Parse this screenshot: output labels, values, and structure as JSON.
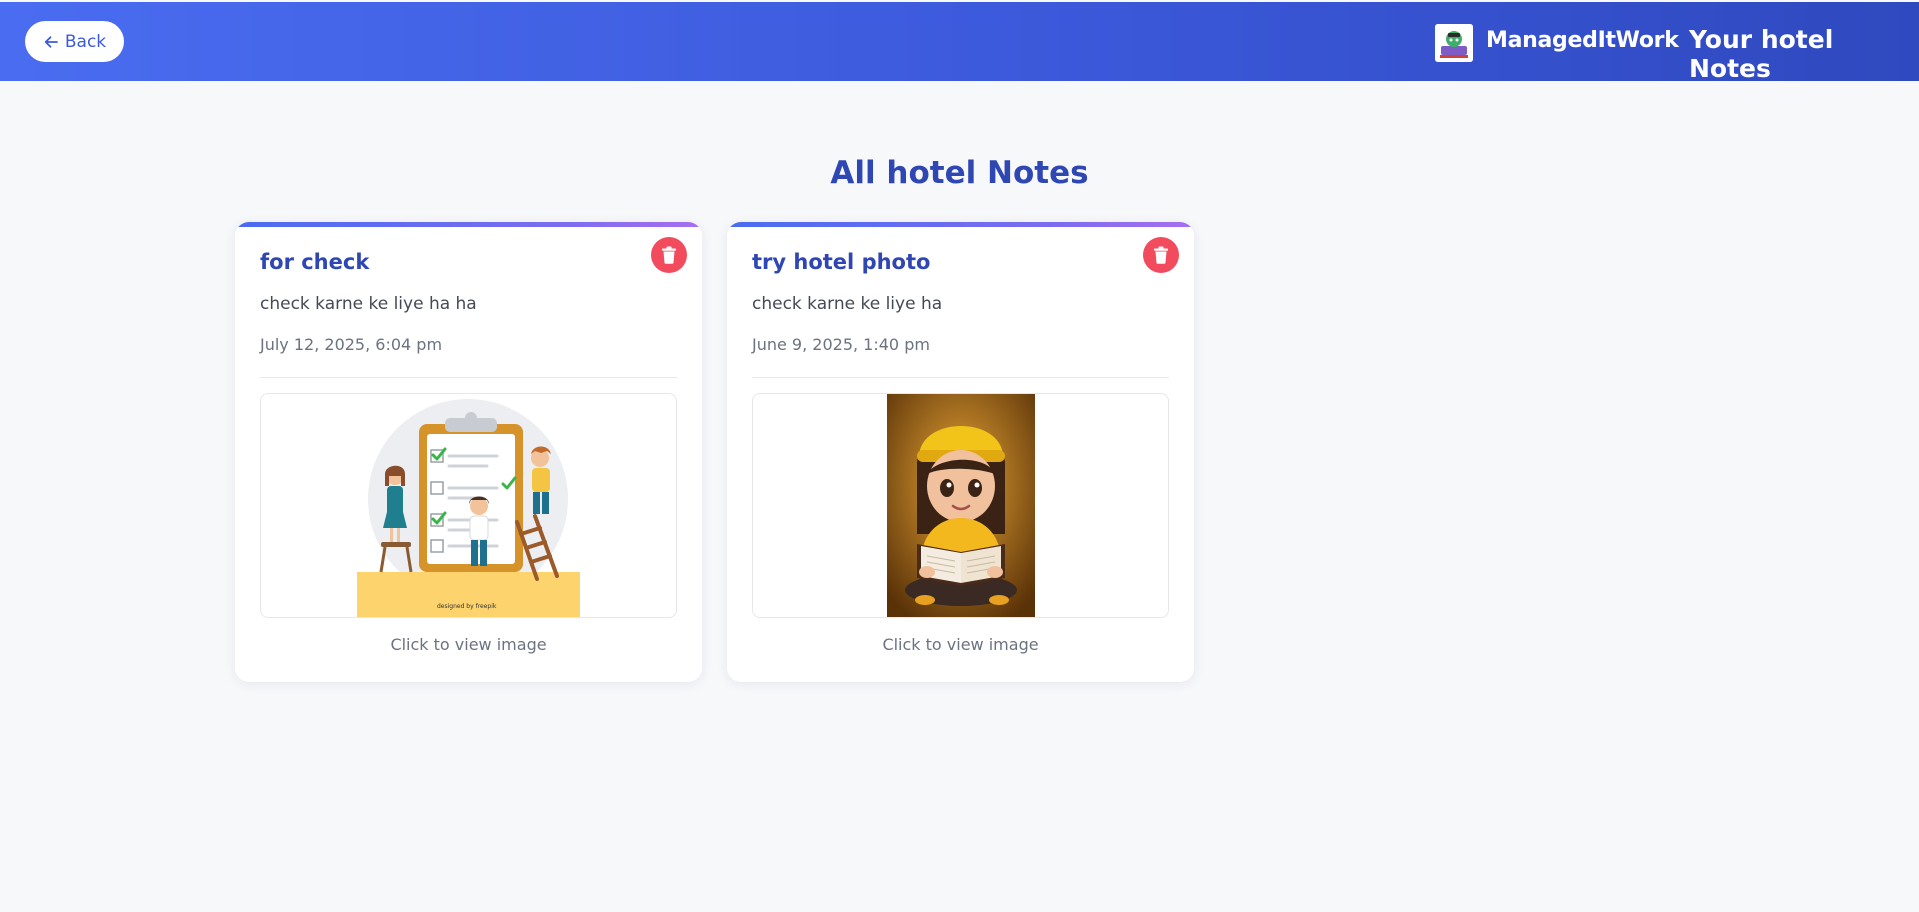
{
  "header": {
    "back_label": "Back",
    "brand_name": "ManagedItWork",
    "page_heading": "Your hotel Notes"
  },
  "main": {
    "title": "All hotel Notes"
  },
  "notes": [
    {
      "title": "for check",
      "body": "check karne ke liye ha ha",
      "date": "July 12, 2025, 6:04 pm",
      "image_caption": "Click to view image",
      "image_credit": "designed by freepik"
    },
    {
      "title": "try hotel photo",
      "body": "check karne ke liye ha",
      "date": "June 9, 2025, 1:40 pm",
      "image_caption": "Click to view image"
    }
  ],
  "colors": {
    "header_gradient_start": "#4a6cf0",
    "header_gradient_end": "#2f49bf",
    "accent_text": "#2f47b3",
    "delete_red": "#f24b5e",
    "page_background": "#f7f8fa"
  },
  "icons": {
    "back": "arrow-left-icon",
    "delete": "trash-icon",
    "brand": "brand-logo"
  }
}
